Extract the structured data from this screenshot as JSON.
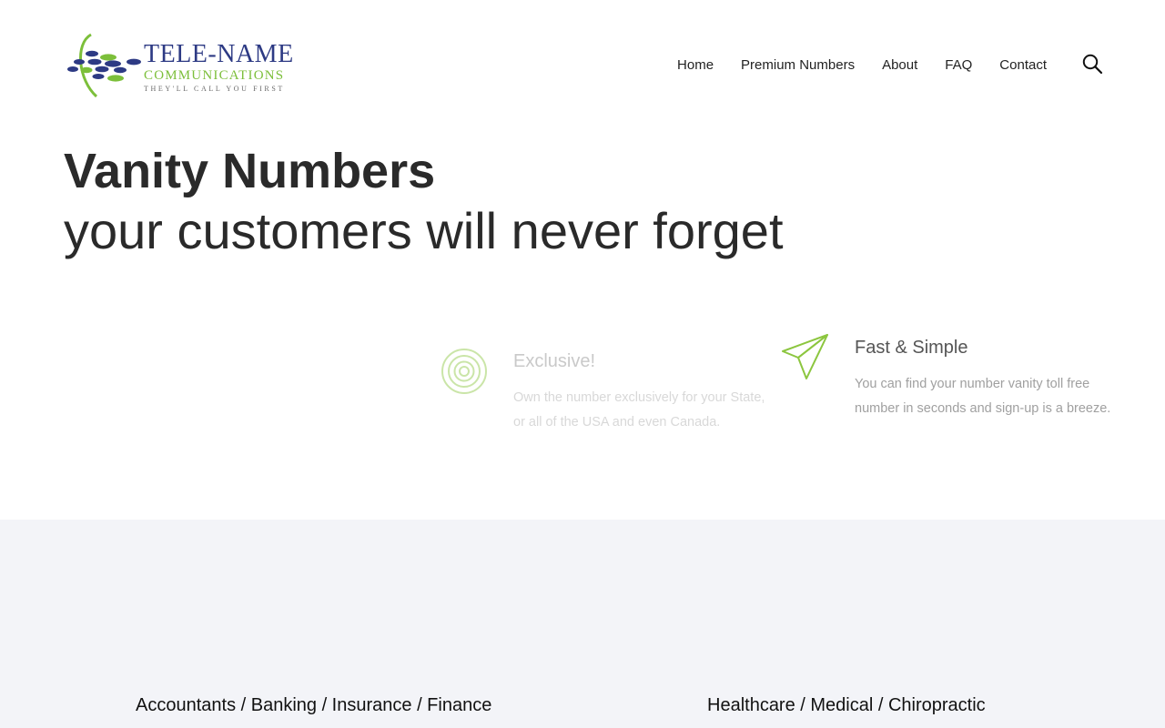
{
  "brand": {
    "name": "TELE-NAME",
    "subtitle": "COMMUNICATIONS",
    "tagline": "THEY'LL CALL YOU FIRST",
    "colors": {
      "navy": "#2d3a84",
      "green": "#7cbf3a"
    }
  },
  "nav": {
    "items": [
      {
        "label": "Home"
      },
      {
        "label": "Premium Numbers"
      },
      {
        "label": "About"
      },
      {
        "label": "FAQ"
      },
      {
        "label": "Contact"
      }
    ],
    "search_icon": "search-icon"
  },
  "hero": {
    "title": "Vanity Numbers",
    "subtitle": "your customers will never forget"
  },
  "features": [
    {
      "icon": "target-icon",
      "title": "Exclusive!",
      "description": "Own the number exclusively for your State, or all of the USA and even Canada."
    },
    {
      "icon": "paper-plane-icon",
      "title": "Fast & Simple",
      "description": "You can find your number vanity toll free number in seconds and sign-up is a breeze."
    }
  ],
  "categories": [
    {
      "label": "Accountants / Banking / Insurance / Finance"
    },
    {
      "label": "Healthcare / Medical / Chiropractic"
    }
  ],
  "theme": {
    "accent": "#8cc63f",
    "section_bg": "#f3f4f8"
  }
}
